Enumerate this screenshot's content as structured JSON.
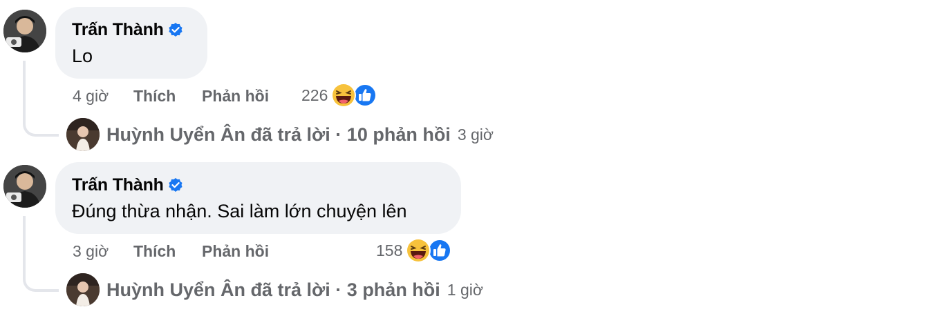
{
  "comments": [
    {
      "author": "Trấn Thành",
      "text": "Lo",
      "time": "4 giờ",
      "like_label": "Thích",
      "reply_label": "Phản hồi",
      "reaction_count": "226",
      "reaction_icons": [
        "haha-icon",
        "like-icon"
      ],
      "replies_summary": {
        "name": "Huỳnh Uyển Ân",
        "action": "đã trả lời",
        "separator": "·",
        "count_text": "10 phản hồi",
        "time": "3 giờ"
      }
    },
    {
      "author": "Trấn Thành",
      "text": "Đúng thừa nhận. Sai làm lớn chuyện lên",
      "time": "3 giờ",
      "like_label": "Thích",
      "reply_label": "Phản hồi",
      "reaction_count": "158",
      "reaction_icons": [
        "haha-icon",
        "like-icon"
      ],
      "replies_summary": {
        "name": "Huỳnh Uyển Ân",
        "action": "đã trả lời",
        "separator": "·",
        "count_text": "3 phản hồi",
        "time": "1 giờ"
      }
    }
  ],
  "colors": {
    "bubble_bg": "#f0f2f5",
    "secondary_text": "#65676b",
    "verified_blue": "#1877f2",
    "thread_line": "#e4e6eb"
  }
}
